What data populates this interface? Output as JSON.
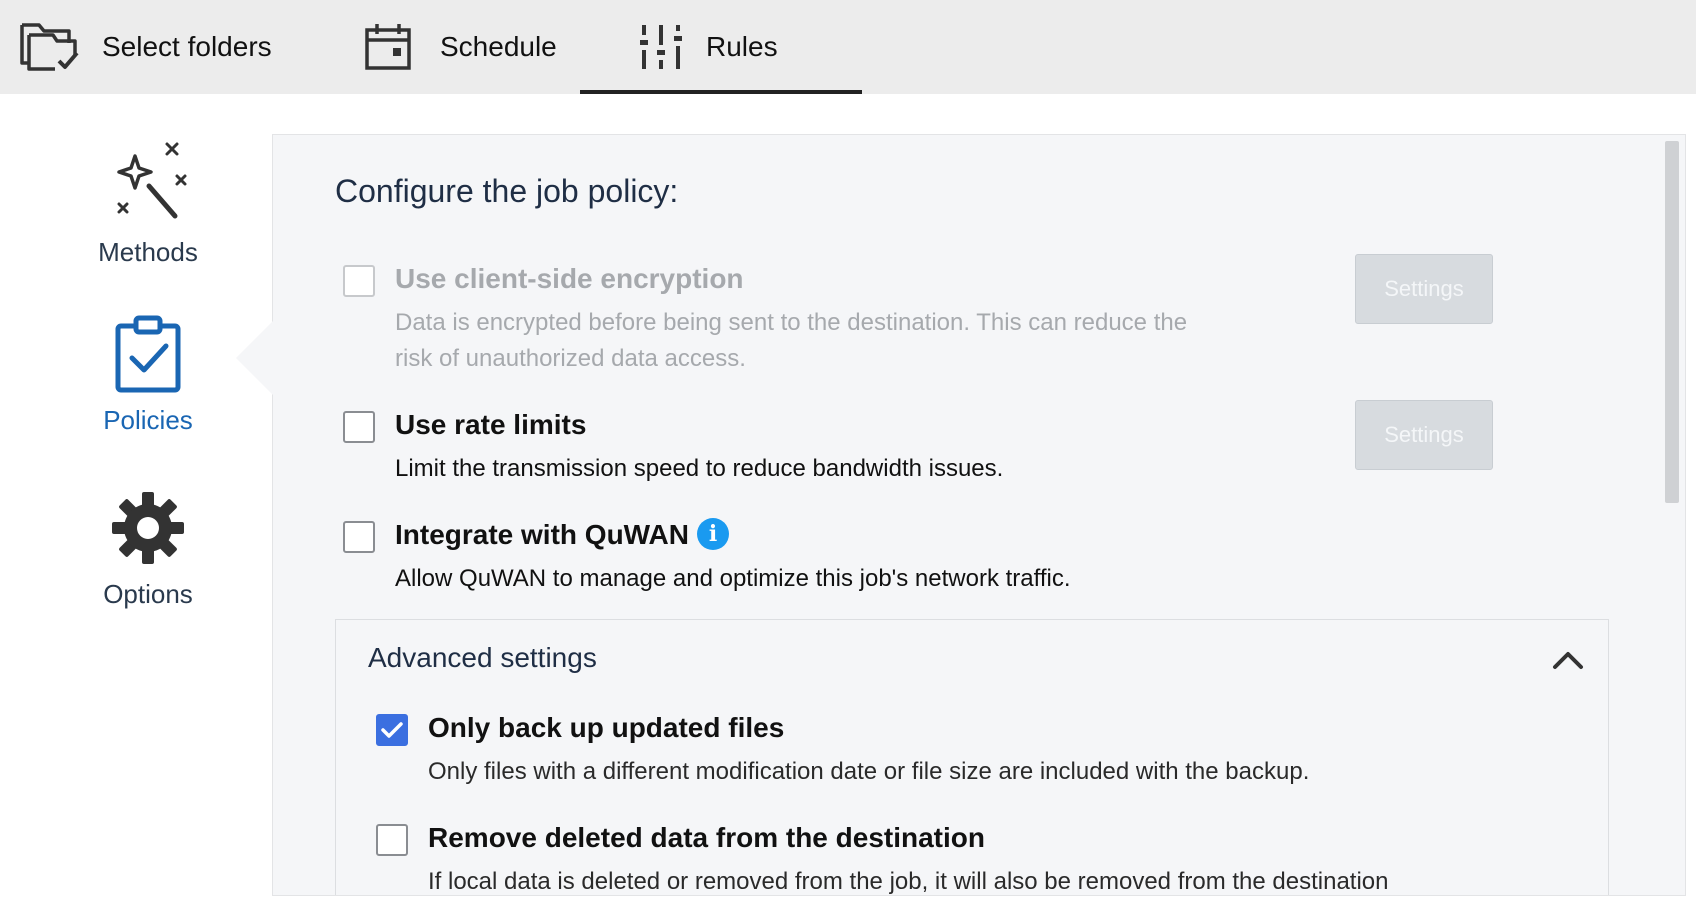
{
  "tabs": [
    {
      "label": "Select folders",
      "icon": "folder-check-icon"
    },
    {
      "label": "Schedule",
      "icon": "calendar-icon"
    },
    {
      "label": "Rules",
      "icon": "sliders-icon",
      "active": true
    }
  ],
  "sidebar": {
    "items": [
      {
        "label": "Methods",
        "icon": "magic-wand-icon"
      },
      {
        "label": "Policies",
        "icon": "clipboard-check-icon",
        "active": true
      },
      {
        "label": "Options",
        "icon": "gear-icon"
      }
    ]
  },
  "main": {
    "heading": "Configure the job policy:",
    "options": [
      {
        "title": "Use client-side encryption",
        "desc_lines": [
          "Data is encrypted before being sent to the destination. This can reduce the",
          "risk of unauthorized data access."
        ],
        "checked": false,
        "disabled": true,
        "button": "Settings"
      },
      {
        "title": "Use rate limits",
        "desc_lines": [
          "Limit the transmission speed to reduce bandwidth issues."
        ],
        "checked": false,
        "disabled": false,
        "button": "Settings"
      },
      {
        "title": "Integrate with QuWAN",
        "info_icon": "i",
        "desc_lines": [
          "Allow QuWAN to manage and optimize this job's network traffic."
        ],
        "checked": false,
        "disabled": false
      }
    ],
    "advanced": {
      "title": "Advanced settings",
      "expanded": true,
      "options": [
        {
          "title": "Only back up updated files",
          "desc": "Only files with a different modification date or file size are included with the backup.",
          "checked": true
        },
        {
          "title": "Remove deleted data from the destination",
          "desc": "If local data is deleted or removed from the job, it will also be removed from the destination",
          "checked": false
        }
      ]
    }
  },
  "colors": {
    "accent": "#3b6fe0",
    "active_side": "#1a66b3",
    "info": "#1a9af0",
    "topbar": "#ececec",
    "panel": "#f5f6f8"
  }
}
